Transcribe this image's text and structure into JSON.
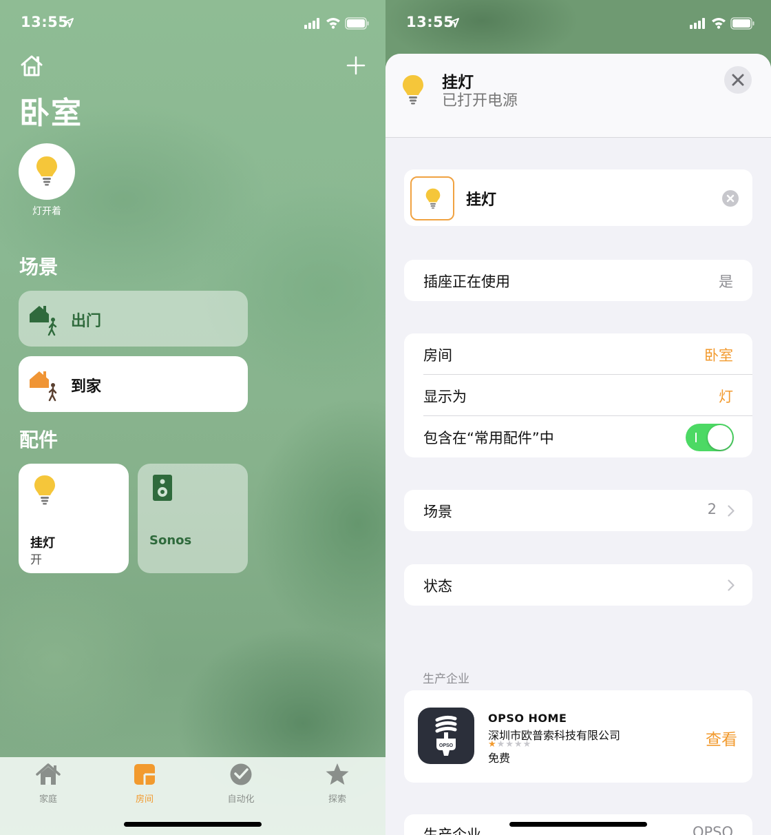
{
  "status_bar": {
    "time": "13:55"
  },
  "left": {
    "room_title": "卧室",
    "status_tile_label": "灯开着",
    "scenes_title": "场景",
    "scenes": [
      {
        "label": "出门",
        "active": false
      },
      {
        "label": "到家",
        "active": true
      }
    ],
    "accessories_title": "配件",
    "accessories": [
      {
        "name": "挂灯",
        "state": "开",
        "icon": "lightbulb-icon"
      },
      {
        "name": "Sonos",
        "state": "",
        "icon": "speaker-icon"
      }
    ],
    "tabs": [
      {
        "label": "家庭",
        "icon": "house-icon",
        "active": false
      },
      {
        "label": "房间",
        "icon": "rooms-icon",
        "active": true
      },
      {
        "label": "自动化",
        "icon": "clock-check-icon",
        "active": false
      },
      {
        "label": "探索",
        "icon": "star-icon",
        "active": false
      }
    ]
  },
  "right": {
    "header": {
      "name": "挂灯",
      "subtitle": "已打开电源"
    },
    "name_field": {
      "value": "挂灯"
    },
    "outlet_in_use": {
      "label": "插座正在使用",
      "value": "是"
    },
    "settings": {
      "room": {
        "label": "房间",
        "value": "卧室"
      },
      "display_as": {
        "label": "显示为",
        "value": "灯"
      },
      "favorites": {
        "label": "包含在“常用配件”中",
        "enabled": true
      }
    },
    "scenes_row": {
      "label": "场景",
      "value": "2"
    },
    "status_row": {
      "label": "状态"
    },
    "manufacturer": {
      "section_title": "生产企业",
      "app_name": "OPSO HOME",
      "developer": "深圳市欧普索科技有限公司",
      "rating": 1,
      "price": "免费",
      "action": "查看"
    },
    "bottom_row": {
      "label": "生产企业",
      "value": "OPSO"
    }
  },
  "colors": {
    "accent_orange": "#f29a2e",
    "toggle_green": "#4cd964",
    "bulb_yellow": "#f5c63a",
    "scene_green": "#2f6a3c"
  }
}
